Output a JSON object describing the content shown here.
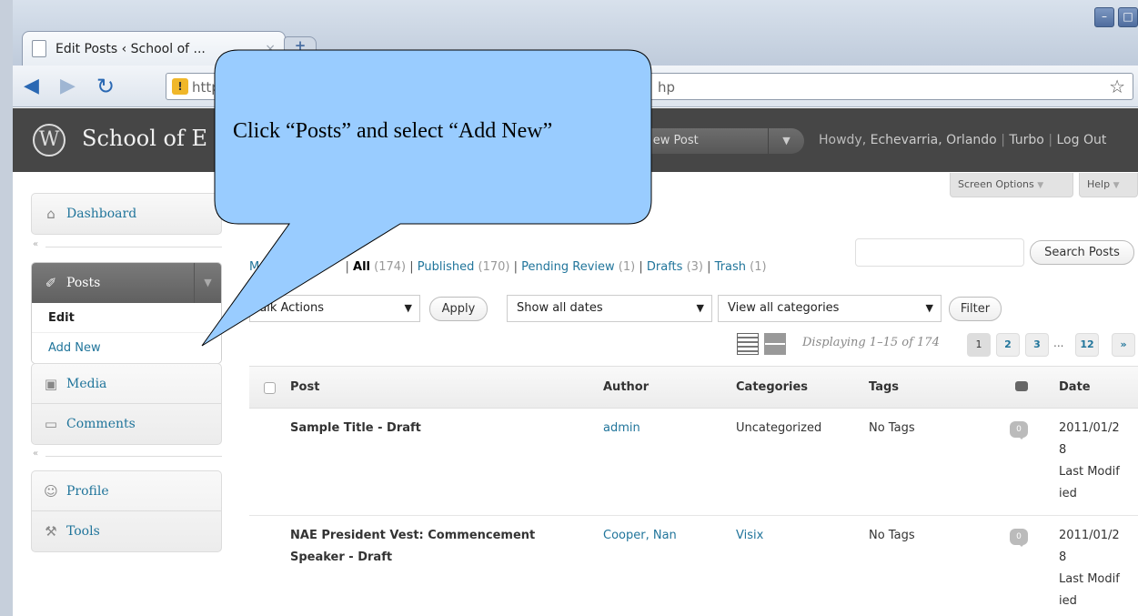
{
  "browser": {
    "tab_title": "Edit Posts ‹ School of ...",
    "tab_close": "×",
    "new_tab": "+",
    "window_buttons": [
      "–",
      "□"
    ],
    "url_visible_start": "http",
    "url_visible_end": "hp",
    "icons": [
      "back-arrow-icon",
      "forward-arrow-icon",
      "reload-icon",
      "warning-lock-icon",
      "star-icon"
    ]
  },
  "header": {
    "site_title": "School of E",
    "new_post_label": "New Post",
    "new_post_arrow": "▼",
    "howdy": "Howdy,",
    "user": "Echevarria, Orlando",
    "turbo": "Turbo",
    "logout": "Log Out",
    "sep": "|"
  },
  "screen_options": {
    "screen_options_label": "Screen Options",
    "help_label": "Help",
    "arrow": "▼"
  },
  "sidebar": {
    "dashboard": "Dashboard",
    "collapse_glyph": "«",
    "posts": "Posts",
    "posts_toggle": "▼",
    "posts_sub": {
      "edit": "Edit",
      "add_new": "Add New"
    },
    "media": "Media",
    "comments": "Comments",
    "profile": "Profile",
    "tools": "Tools"
  },
  "filters": {
    "views": {
      "mine_prefix": "M",
      "all": "All",
      "all_count": "(174)",
      "published": "Published",
      "published_count": "(170)",
      "pending": "Pending Review",
      "pending_count": "(1)",
      "drafts": "Drafts",
      "drafts_count": "(3)",
      "trash": "Trash",
      "trash_count": "(1)",
      "sep": "|"
    },
    "search_value": "",
    "search_button": "Search Posts",
    "bulk_actions": "ulk Actions",
    "apply_button": "Apply",
    "dates": "Show all dates",
    "categories": "View all categories",
    "filter_button": "Filter",
    "select_arrow": "▼"
  },
  "pagination": {
    "displaying": "Displaying 1–15 of 174",
    "pages": [
      "1",
      "2",
      "3"
    ],
    "dots": "...",
    "last": "12",
    "next": "»"
  },
  "table": {
    "headers": {
      "post": "Post",
      "author": "Author",
      "categories": "Categories",
      "tags": "Tags",
      "date": "Date"
    },
    "rows": [
      {
        "title": "Sample Title - Draft",
        "author": "admin",
        "categories": "Uncategorized",
        "tags": "No Tags",
        "comments": "0",
        "date": "2011/01/28",
        "date_status": "Last Modified"
      },
      {
        "title": "NAE President Vest: Commencement Speaker - Draft",
        "author": "Cooper, Nan",
        "categories": "Visix",
        "tags": "No Tags",
        "comments": "0",
        "date": "2011/01/28",
        "date_status": "Last Modified"
      }
    ]
  },
  "callout": {
    "text": "Click “Posts” and select “Add New”",
    "fill": "#99ccff",
    "stroke": "#000000"
  }
}
